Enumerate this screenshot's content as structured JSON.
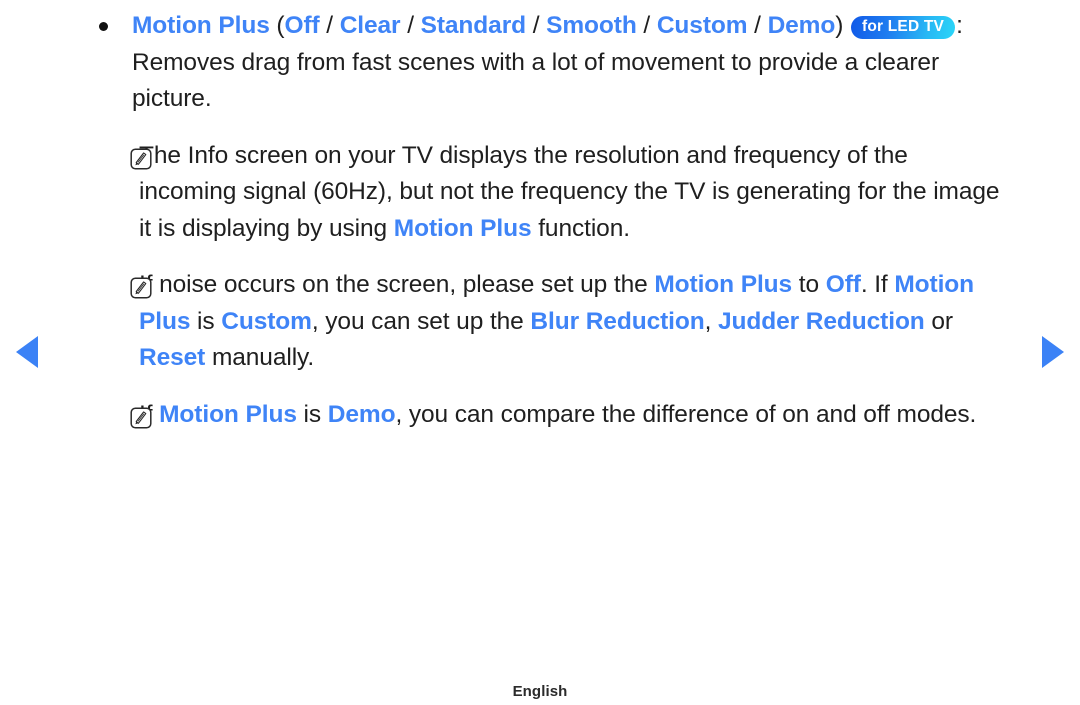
{
  "nav": {
    "prev_label": "previous page",
    "next_label": "next page"
  },
  "footer": {
    "language": "English"
  },
  "badge": {
    "label": "for LED TV"
  },
  "colors": {
    "keyword_blue": "#3f84f7",
    "nav_arrow_blue": "#3b82f6",
    "badge_gradient_start": "#1159e8",
    "badge_gradient_end": "#2ad6f8",
    "body_text": "#1f1f1f"
  },
  "content": {
    "bullet": {
      "icon": "bullet-dot",
      "title_keyword": "Motion Plus",
      "open_paren": " (",
      "options": [
        "Off",
        "Clear",
        "Standard",
        "Smooth",
        "Custom",
        "Demo"
      ],
      "separator": " / ",
      "close_paren": ") ",
      "colon": ":",
      "body": "Removes drag from fast scenes with a lot of movement to provide a clearer picture."
    },
    "notes": [
      {
        "icon": "note-pencil-icon",
        "seg1": "The Info screen on your TV displays the resolution and frequency of the incoming signal (60Hz), but not the frequency the TV is generating for the image it is displaying by using ",
        "kw1": "Motion Plus",
        "seg2": " function."
      },
      {
        "icon": "note-pencil-icon",
        "seg1": "If noise occurs on the screen, please set up the ",
        "kw1": "Motion Plus",
        "seg2": " to ",
        "kw2": "Off",
        "seg3": ". If ",
        "kw3": "Motion Plus",
        "seg4": " is ",
        "kw4": "Custom",
        "seg5": ", you can set up the ",
        "kw5": "Blur Reduction",
        "seg6": ", ",
        "kw6": "Judder Reduction",
        "seg7": " or ",
        "kw7": "Reset",
        "seg8": " manually."
      },
      {
        "icon": "note-pencil-icon",
        "seg1": "If ",
        "kw1": "Motion Plus",
        "seg2": " is ",
        "kw2": "Demo",
        "seg3": ", you can compare the difference of on and off modes."
      }
    ]
  }
}
